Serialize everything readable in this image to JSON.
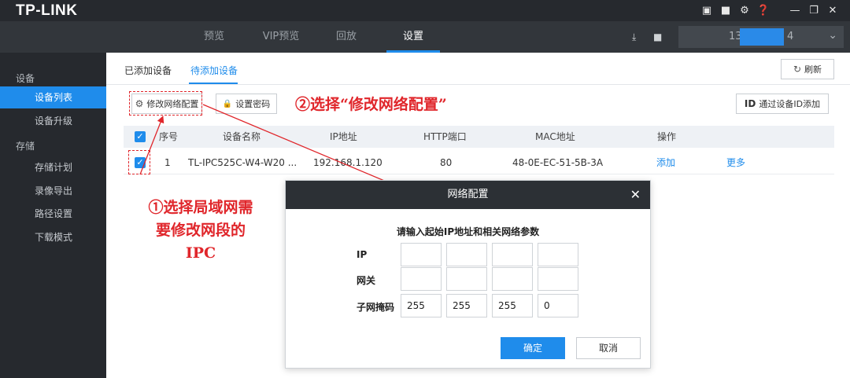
{
  "app": {
    "logo": "TP-LINK"
  },
  "window_controls": {
    "icons": [
      "layout-icon",
      "cpu-icon",
      "gear-icon",
      "help-icon",
      "minimize-icon",
      "restore-icon",
      "close-icon"
    ],
    "glyphs": [
      "▣",
      "■",
      "⚙",
      "❓",
      "—",
      "❐",
      "✕"
    ]
  },
  "nav": {
    "tabs": [
      {
        "label": "预览",
        "active": false
      },
      {
        "label": "VIP预览",
        "active": false
      },
      {
        "label": "回放",
        "active": false
      },
      {
        "label": "设置",
        "active": true
      }
    ],
    "download_icon": "⤓",
    "folder_icon": "■",
    "account": {
      "prefix": "13",
      "suffix": "4",
      "chevron": "⌄"
    }
  },
  "sidebar": {
    "group_device": "设备",
    "item_device_list": "设备列表",
    "item_device_upgrade": "设备升级",
    "group_storage": "存储",
    "item_storage_plan": "存储计划",
    "item_video_export": "录像导出",
    "item_path_settings": "路径设置",
    "item_download_mode": "下载模式"
  },
  "content": {
    "tab_added": "已添加设备",
    "tab_pending": "待添加设备",
    "refresh_label": "刷新",
    "refresh_icon": "↻",
    "modify_network_label": "修改网络配置",
    "modify_network_icon": "⚙",
    "set_password_label": "设置密码",
    "set_password_icon": "🔒",
    "add_by_id_prefix": "ID",
    "add_by_id_label": "通过设备ID添加",
    "table": {
      "headers": [
        "序号",
        "设备名称",
        "IP地址",
        "HTTP端口",
        "MAC地址",
        "操作"
      ],
      "rows": [
        {
          "index": "1",
          "name": "TL-IPC525C-W4-W20 ...",
          "ip": "192.168.1.120",
          "http_port": "80",
          "mac": "48-0E-EC-51-5B-3A",
          "action_add": "添加",
          "action_more": "更多"
        }
      ]
    }
  },
  "annotations": {
    "step2": "②选择“修改网络配置”",
    "step1_lines": [
      "①选择局域网需",
      "要修改网段的",
      "IPC"
    ],
    "color": "#e0262b"
  },
  "dialog": {
    "title": "网络配置",
    "close_glyph": "✕",
    "prompt": "请输入起始IP地址和相关网络参数",
    "label_ip": "IP",
    "label_gateway": "网关",
    "label_subnet": "子网掩码",
    "ip_values": [
      "",
      "",
      "",
      ""
    ],
    "gateway_values": [
      "",
      "",
      "",
      ""
    ],
    "subnet_values": [
      "255",
      "255",
      "255",
      "0"
    ],
    "ok_label": "确定",
    "cancel_label": "取消"
  },
  "colors": {
    "accent": "#1f8ceb",
    "titlebar": "#26292e",
    "navbar": "#32363b",
    "annotation": "#e0262b"
  }
}
